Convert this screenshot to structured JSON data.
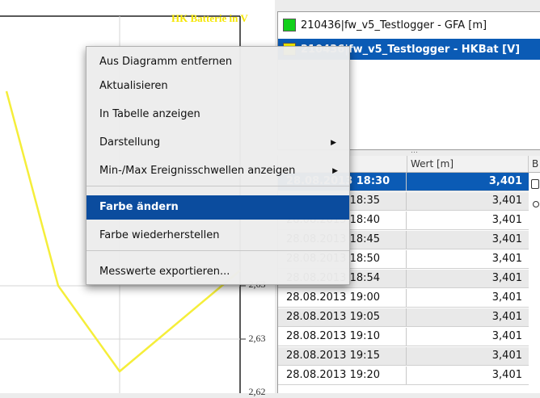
{
  "chart": {
    "title": "HK Batterie in V",
    "ticks": [
      "2,63",
      "2,63",
      "2,62"
    ],
    "line_color": "#f5ee3a"
  },
  "legend": {
    "items": [
      {
        "label": "210436|fw_v5_Testlogger - GFA [m]",
        "color": "#12d01a",
        "selected": false
      },
      {
        "label": "210436|fw_v5_Testlogger - HKBat [V]",
        "color": "#f5ee00",
        "selected": true
      }
    ]
  },
  "table": {
    "columns": [
      "",
      "Wert [m]",
      "B"
    ],
    "rows": [
      {
        "time": "28.08.2013 18:30",
        "value": "3,401",
        "selected": true
      },
      {
        "time": "28.08.2013 18:35",
        "value": "3,401"
      },
      {
        "time": "28.08.2013 18:40",
        "value": "3,401"
      },
      {
        "time": "28.08.2013 18:45",
        "value": "3,401"
      },
      {
        "time": "28.08.2013 18:50",
        "value": "3,401"
      },
      {
        "time": "28.08.2013 18:54",
        "value": "3,401"
      },
      {
        "time": "28.08.2013 19:00",
        "value": "3,401"
      },
      {
        "time": "28.08.2013 19:05",
        "value": "3,401"
      },
      {
        "time": "28.08.2013 19:10",
        "value": "3,401"
      },
      {
        "time": "28.08.2013 19:15",
        "value": "3,401"
      },
      {
        "time": "28.08.2013 19:20",
        "value": "3,401"
      }
    ]
  },
  "context_menu": {
    "items": [
      {
        "label": "Aus Diagramm entfernen"
      },
      {
        "label": "Aktualisieren"
      },
      {
        "label": "In Tabelle anzeigen"
      },
      {
        "label": "Darstellung",
        "submenu": true
      },
      {
        "label": "Min-/Max Ereignisschwellen anzeigen",
        "submenu": true
      },
      {
        "label": "Farbe ändern",
        "highlighted": true
      },
      {
        "label": "Farbe wiederherstellen"
      },
      {
        "label": "Messwerte exportieren..."
      }
    ]
  }
}
